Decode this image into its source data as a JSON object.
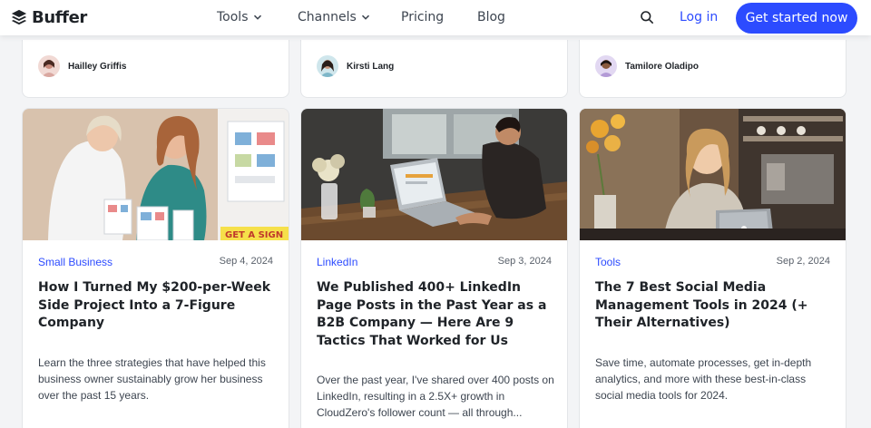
{
  "brand": {
    "name": "Buffer"
  },
  "nav": {
    "items": [
      {
        "label": "Tools",
        "has_dropdown": true
      },
      {
        "label": "Channels",
        "has_dropdown": true
      },
      {
        "label": "Pricing",
        "has_dropdown": false
      },
      {
        "label": "Blog",
        "has_dropdown": false
      }
    ],
    "search_icon": "search-icon",
    "login_label": "Log in",
    "cta_label": "Get started now"
  },
  "top_authors": [
    {
      "name": "Hailley Griffis",
      "avatar_color": "#d9a7a0"
    },
    {
      "name": "Kirsti Lang",
      "avatar_color": "#7fb7c9"
    },
    {
      "name": "Tamilore Oladipo",
      "avatar_color": "#b39ad6"
    }
  ],
  "posts": [
    {
      "tag": "Small Business",
      "date": "Sep 4, 2024",
      "title": "How I Turned My $200-per-Week Side Project Into a 7-Figure Company",
      "excerpt": "Learn the three strategies that have helped this business owner sustainably grow her business over the past 15 years.",
      "image_caption": "GET A SIGN"
    },
    {
      "tag": "LinkedIn",
      "date": "Sep 3, 2024",
      "title": "We Published 400+ LinkedIn Page Posts in the Past Year as a B2B Company — Here Are 9 Tactics That Worked for Us",
      "excerpt": "Over the past year, I've shared over 400 posts on LinkedIn, resulting in a 2.5X+ growth in CloudZero's follower count — all through..."
    },
    {
      "tag": "Tools",
      "date": "Sep 2, 2024",
      "title": "The 7 Best Social Media Management Tools in 2024 (+ Their Alternatives)",
      "excerpt": "Save time, automate processes, get in-depth analytics, and more with these best-in-class social media tools for 2024."
    }
  ],
  "colors": {
    "accent": "#2c4bff",
    "text": "#1f2328",
    "muted": "#59606a",
    "background": "#f3f4f6"
  }
}
